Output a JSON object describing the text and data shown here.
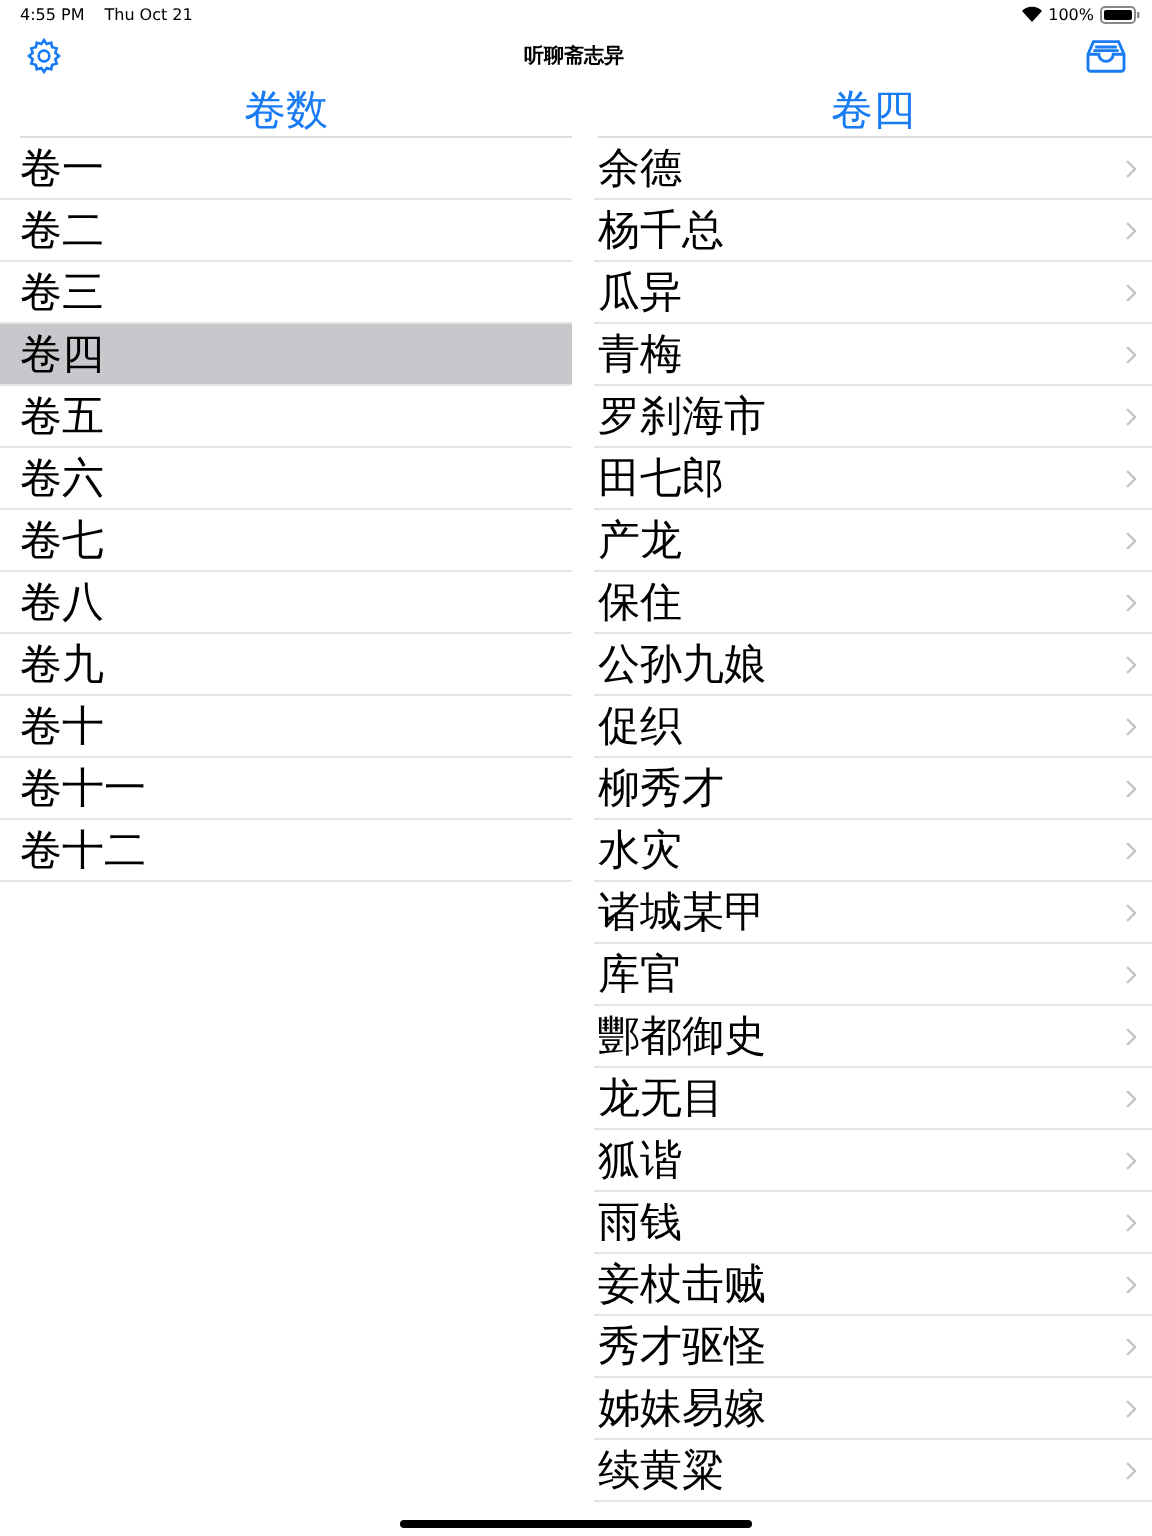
{
  "status_bar": {
    "time": "4:55 PM",
    "date": "Thu Oct 21",
    "battery": "100%"
  },
  "nav_bar": {
    "title": "听聊斋志异"
  },
  "volumes": {
    "header": "卷数",
    "items": [
      {
        "label": "卷一",
        "selected": false
      },
      {
        "label": "卷二",
        "selected": false
      },
      {
        "label": "卷三",
        "selected": false
      },
      {
        "label": "卷四",
        "selected": true
      },
      {
        "label": "卷五",
        "selected": false
      },
      {
        "label": "卷六",
        "selected": false
      },
      {
        "label": "卷七",
        "selected": false
      },
      {
        "label": "卷八",
        "selected": false
      },
      {
        "label": "卷九",
        "selected": false
      },
      {
        "label": "卷十",
        "selected": false
      },
      {
        "label": "卷十一",
        "selected": false
      },
      {
        "label": "卷十二",
        "selected": false
      }
    ]
  },
  "stories": {
    "header": "卷四",
    "items": [
      "余德",
      "杨千总",
      "瓜异",
      "青梅",
      "罗刹海市",
      "田七郎",
      "产龙",
      "保住",
      "公孙九娘",
      "促织",
      "柳秀才",
      "水灾",
      "诸城某甲",
      "库官",
      "酆都御史",
      "龙无目",
      "狐谐",
      "雨钱",
      "妾杖击贼",
      "秀才驱怪",
      "姊妹易嫁",
      "续黄粱"
    ]
  }
}
